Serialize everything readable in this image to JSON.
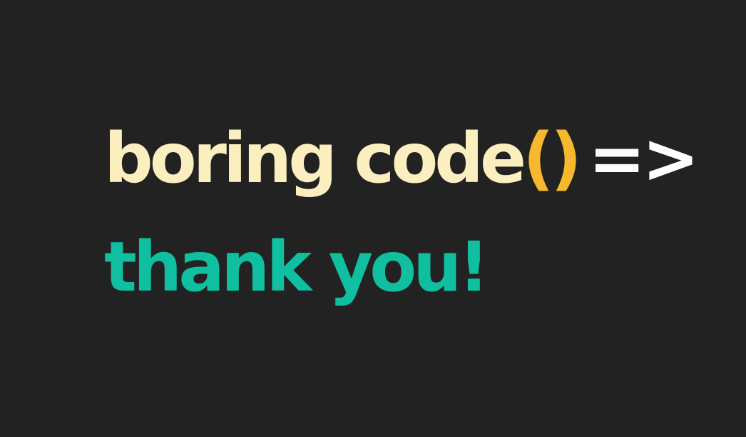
{
  "line1": {
    "function_name": "boring code",
    "parens": "()",
    "arrow": "=>"
  },
  "line2": {
    "text": "thank you!"
  },
  "colors": {
    "background": "#222222",
    "function_name": "#fcefbf",
    "parens": "#f5b82e",
    "arrow": "#ffffff",
    "thanks": "#10bfa0"
  }
}
